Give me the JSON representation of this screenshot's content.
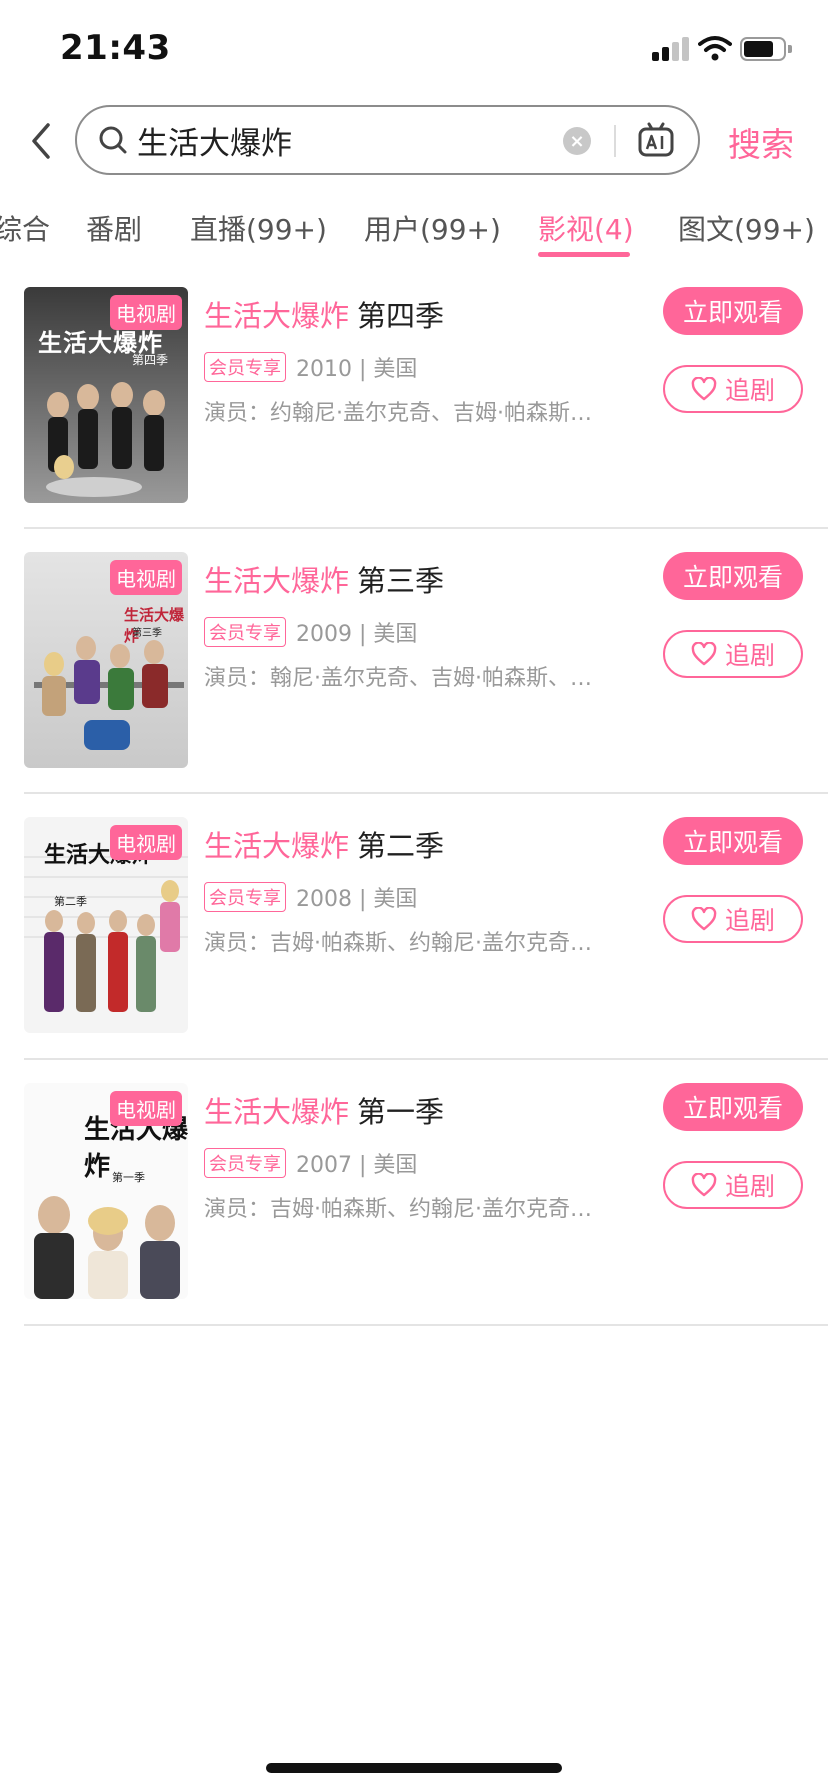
{
  "status": {
    "time": "21:43",
    "battery_level": 0.75
  },
  "search": {
    "query": "生活大爆炸",
    "action_label": "搜索"
  },
  "tabs": [
    {
      "label": "综合"
    },
    {
      "label": "番剧"
    },
    {
      "label": "直播(99+)"
    },
    {
      "label": "用户(99+)"
    },
    {
      "label": "影视(4)",
      "active": true
    },
    {
      "label": "图文(99+)"
    }
  ],
  "results": [
    {
      "badge": "电视剧",
      "title_highlight": "生活大爆炸",
      "title_rest": "第四季",
      "vip_tag": "会员专享",
      "meta": "2010 | 美国",
      "cast": "演员：约翰尼·盖尔克奇、吉姆·帕森斯…",
      "watch_label": "立即观看",
      "follow_label": "追剧",
      "poster_text": "生活大爆炸",
      "poster_sub": "第四季"
    },
    {
      "badge": "电视剧",
      "title_highlight": "生活大爆炸",
      "title_rest": "第三季",
      "vip_tag": "会员专享",
      "meta": "2009 | 美国",
      "cast": "演员：翰尼·盖尔克奇、吉姆·帕森斯、…",
      "watch_label": "立即观看",
      "follow_label": "追剧",
      "poster_text": "生活大爆炸",
      "poster_sub": "第三季"
    },
    {
      "badge": "电视剧",
      "title_highlight": "生活大爆炸",
      "title_rest": "第二季",
      "vip_tag": "会员专享",
      "meta": "2008 | 美国",
      "cast": "演员：吉姆·帕森斯、约翰尼·盖尔克奇…",
      "watch_label": "立即观看",
      "follow_label": "追剧",
      "poster_text": "生活大爆炸",
      "poster_sub": "第二季"
    },
    {
      "badge": "电视剧",
      "title_highlight": "生活大爆炸",
      "title_rest": "第一季",
      "vip_tag": "会员专享",
      "meta": "2007 | 美国",
      "cast": "演员：吉姆·帕森斯、约翰尼·盖尔克奇…",
      "watch_label": "立即观看",
      "follow_label": "追剧",
      "poster_text": "生活大爆炸",
      "poster_sub": "第一季"
    }
  ],
  "colors": {
    "accent": "#ff6699",
    "text": "#212121",
    "muted": "#999999"
  }
}
